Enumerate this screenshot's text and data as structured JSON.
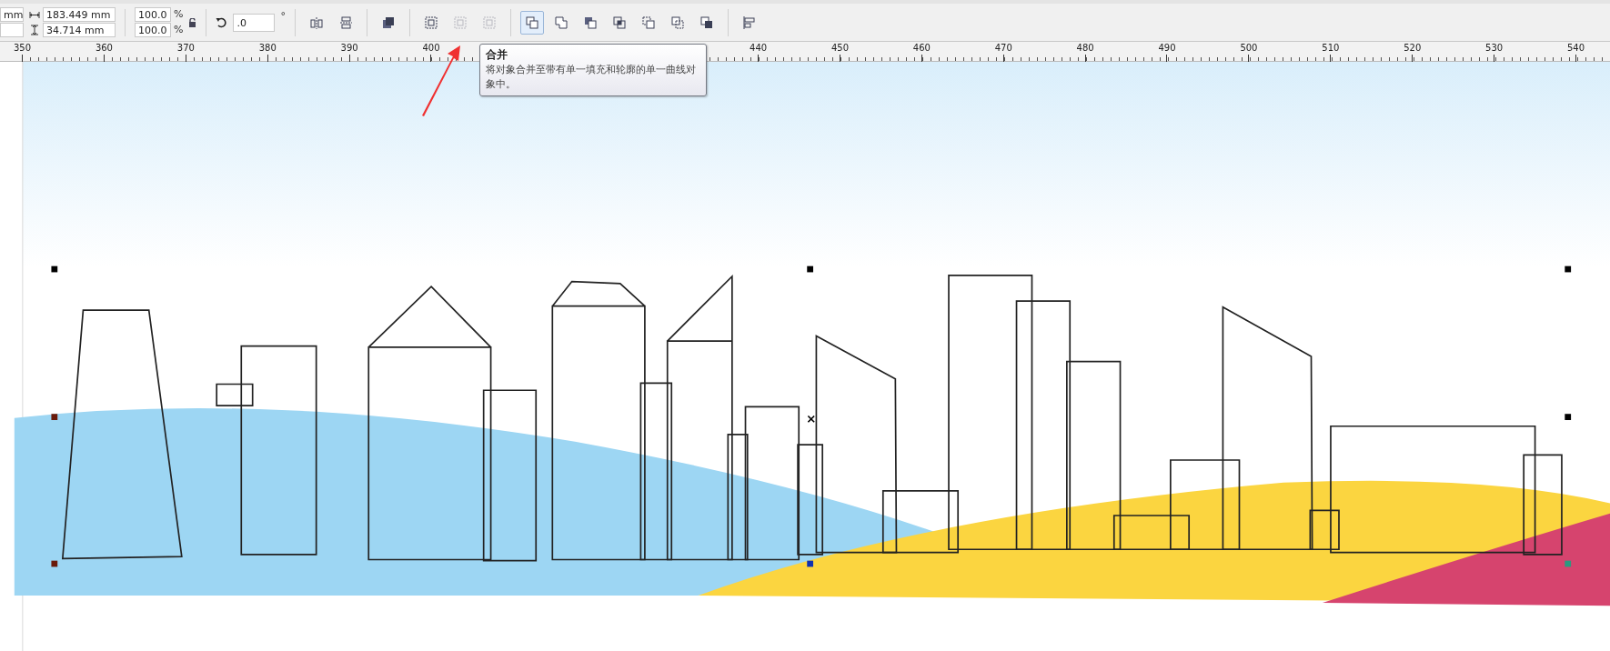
{
  "toolbar": {
    "unit_field": {
      "value": "mm"
    },
    "size_fields": [
      {
        "kind": "width",
        "value": "183.449 mm"
      },
      {
        "kind": "height",
        "value": "34.714 mm"
      }
    ],
    "scale_fields": [
      {
        "value": "100.0",
        "unit": "%"
      },
      {
        "value": "100.0",
        "unit": "%"
      }
    ],
    "lock": {
      "on": false
    },
    "rotation": {
      "value": ".0",
      "unit": "°"
    },
    "buttons": [
      {
        "kind": "mirror-h",
        "disabled": false,
        "selected": false
      },
      {
        "kind": "mirror-v",
        "disabled": false,
        "selected": false
      },
      {
        "kind": "sep"
      },
      {
        "kind": "arrange",
        "disabled": false,
        "selected": false
      },
      {
        "kind": "sep"
      },
      {
        "kind": "group",
        "disabled": false,
        "selected": false
      },
      {
        "kind": "ungroup",
        "disabled": true,
        "selected": false
      },
      {
        "kind": "ungroup-all",
        "disabled": true,
        "selected": false
      },
      {
        "kind": "sep"
      },
      {
        "kind": "combine",
        "disabled": false,
        "selected": true
      },
      {
        "kind": "weld",
        "disabled": false,
        "selected": false
      },
      {
        "kind": "trim",
        "disabled": false,
        "selected": false
      },
      {
        "kind": "intersect",
        "disabled": false,
        "selected": false
      },
      {
        "kind": "simplify",
        "disabled": false,
        "selected": false
      },
      {
        "kind": "front-minus-back",
        "disabled": false,
        "selected": false
      },
      {
        "kind": "back-minus-front",
        "disabled": false,
        "selected": false
      },
      {
        "kind": "sep"
      },
      {
        "kind": "align",
        "disabled": false,
        "selected": false
      }
    ]
  },
  "ruler": {
    "segments": [
      {
        "labels": [
          "350",
          "360",
          "370",
          "380",
          "390",
          "400"
        ]
      },
      {
        "labels": [
          "440",
          "450",
          "460",
          "470",
          "480",
          "490",
          "500",
          "510",
          "520",
          "530",
          "540"
        ]
      }
    ]
  },
  "tooltip": {
    "title": "合并",
    "text": "将对象合并至带有单一填充和轮廓的单一曲线对象中。"
  }
}
